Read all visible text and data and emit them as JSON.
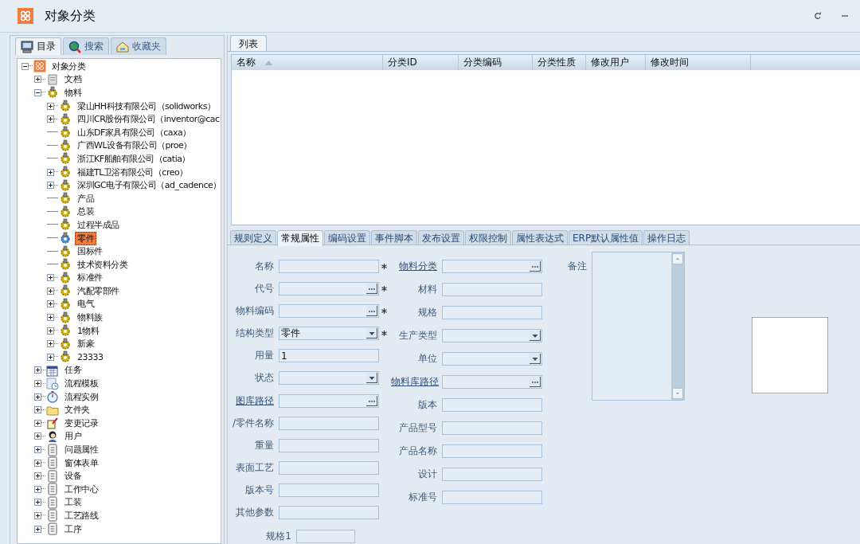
{
  "window": {
    "title": "对象分类"
  },
  "left_tabs": [
    {
      "label": "目录",
      "kind": "monitor",
      "selected": true
    },
    {
      "label": "搜索",
      "kind": "search",
      "selected": false
    },
    {
      "label": "收藏夹",
      "kind": "favorites",
      "selected": false
    }
  ],
  "tree": [
    {
      "label": "对象分类",
      "kind": "app",
      "expanded": true,
      "selected": false,
      "children": [
        {
          "label": "文档",
          "kind": "doc",
          "expanded": false,
          "selected": false
        },
        {
          "label": "物料",
          "kind": "gear",
          "expanded": true,
          "selected": false,
          "children": [
            {
              "label": "梁山HH科技有限公司（solidworks）",
              "kind": "gear",
              "expanded": false,
              "selected": false
            },
            {
              "label": "四川CR股份有限公司（inventor@cac",
              "kind": "gear",
              "expanded": false,
              "selected": false
            },
            {
              "label": "山东DF家具有限公司（caxa）",
              "kind": "gear",
              "selected": false
            },
            {
              "label": "广西WL设备有限公司（proe）",
              "kind": "gear",
              "selected": false
            },
            {
              "label": "浙江KF船舶有限公司（catia）",
              "kind": "gear",
              "selected": false
            },
            {
              "label": "福建TL卫浴有限公司（creo）",
              "kind": "gear",
              "expanded": false,
              "selected": false
            },
            {
              "label": "深圳GC电子有限公司（ad_cadence）",
              "kind": "gear",
              "expanded": false,
              "selected": false
            },
            {
              "label": "产品",
              "kind": "gear",
              "selected": false
            },
            {
              "label": "总装",
              "kind": "gear",
              "selected": false
            },
            {
              "label": "过程半成品",
              "kind": "gear",
              "selected": false
            },
            {
              "label": "零件",
              "kind": "gear",
              "selected": true
            },
            {
              "label": "国标件",
              "kind": "gear",
              "selected": false
            },
            {
              "label": "技术资料分类",
              "kind": "gear",
              "selected": false
            },
            {
              "label": "标准件",
              "kind": "gear",
              "expanded": false,
              "selected": false
            },
            {
              "label": "汽配零部件",
              "kind": "gear",
              "expanded": false,
              "selected": false
            },
            {
              "label": "电气",
              "kind": "gear",
              "expanded": false,
              "selected": false
            },
            {
              "label": "物料族",
              "kind": "gear",
              "expanded": false,
              "selected": false
            },
            {
              "label": "1物料",
              "kind": "gear",
              "expanded": false,
              "selected": false
            },
            {
              "label": "新豪",
              "kind": "gear",
              "expanded": false,
              "selected": false
            },
            {
              "label": "23333",
              "kind": "gear",
              "expanded": false,
              "selected": false
            }
          ]
        },
        {
          "label": "任务",
          "kind": "calendar",
          "expanded": false,
          "selected": false
        },
        {
          "label": "流程模板",
          "kind": "template",
          "expanded": false,
          "selected": false
        },
        {
          "label": "流程实例",
          "kind": "clock",
          "expanded": false,
          "selected": false
        },
        {
          "label": "文件夹",
          "kind": "folder",
          "expanded": false,
          "selected": false
        },
        {
          "label": "变更记录",
          "kind": "note",
          "expanded": false,
          "selected": false
        },
        {
          "label": "用户",
          "kind": "user",
          "expanded": false,
          "selected": false
        },
        {
          "label": "问题属性",
          "kind": "form",
          "expanded": false,
          "selected": false
        },
        {
          "label": "窗体表单",
          "kind": "form",
          "expanded": false,
          "selected": false
        },
        {
          "label": "设备",
          "kind": "form",
          "expanded": false,
          "selected": false
        },
        {
          "label": "工作中心",
          "kind": "form",
          "expanded": false,
          "selected": false
        },
        {
          "label": "工装",
          "kind": "form",
          "expanded": false,
          "selected": false
        },
        {
          "label": "工艺路线",
          "kind": "form",
          "expanded": false,
          "selected": false
        },
        {
          "label": "工序",
          "kind": "form",
          "expanded": false,
          "selected": false
        }
      ]
    }
  ],
  "list_tabs": [
    {
      "label": "列表",
      "selected": true
    }
  ],
  "table": {
    "columns": [
      {
        "label": "名称",
        "sorted": true
      },
      {
        "label": "分类ID",
        "sorted": false
      },
      {
        "label": "分类编码",
        "sorted": false
      },
      {
        "label": "分类性质",
        "sorted": false
      },
      {
        "label": "修改用户",
        "sorted": false
      },
      {
        "label": "修改时间",
        "sorted": false
      }
    ]
  },
  "detail_tabs": [
    {
      "label": "规则定义",
      "selected": false
    },
    {
      "label": "常规属性",
      "selected": true
    },
    {
      "label": "编码设置",
      "selected": false
    },
    {
      "label": "事件脚本",
      "selected": false
    },
    {
      "label": "发布设置",
      "selected": false
    },
    {
      "label": "权限控制",
      "selected": false
    },
    {
      "label": "属性表达式",
      "selected": false
    },
    {
      "label": "ERP默认属性值",
      "selected": false
    },
    {
      "label": "操作日志",
      "selected": false
    }
  ],
  "form": {
    "left_fields": [
      {
        "label": "名称",
        "kind": "text",
        "required": true,
        "link": false
      },
      {
        "label": "代号",
        "kind": "lookup",
        "required": true,
        "link": false
      },
      {
        "label": "物料编码",
        "kind": "lookup",
        "required": true,
        "link": false
      },
      {
        "label": "结构类型",
        "kind": "dropdown",
        "value": "零件",
        "required": true,
        "link": false
      },
      {
        "label": "用量",
        "kind": "text",
        "value": "1",
        "required": false,
        "link": false
      },
      {
        "label": "状态",
        "kind": "dropdown",
        "required": false,
        "link": false
      },
      {
        "label": "图库路径",
        "kind": "lookup",
        "required": false,
        "link": true
      },
      {
        "label": "/零件名称",
        "kind": "text",
        "required": false,
        "link": false
      },
      {
        "label": "重量",
        "kind": "text",
        "required": false,
        "link": false
      },
      {
        "label": "表面工艺",
        "kind": "text",
        "required": false,
        "link": false
      },
      {
        "label": "版本号",
        "kind": "text",
        "required": false,
        "link": false
      },
      {
        "label": "其他参数",
        "kind": "text",
        "required": false,
        "link": false
      }
    ],
    "right_fields": [
      {
        "label": "物料分类",
        "kind": "lookup",
        "required": false,
        "link": true
      },
      {
        "label": "材料",
        "kind": "text",
        "required": false,
        "link": false
      },
      {
        "label": "规格",
        "kind": "text",
        "required": false,
        "link": false
      },
      {
        "label": "生产类型",
        "kind": "dropdown",
        "required": false,
        "link": false
      },
      {
        "label": "单位",
        "kind": "dropdown",
        "required": false,
        "link": false
      },
      {
        "label": "物料库路径",
        "kind": "lookup",
        "required": false,
        "link": true
      },
      {
        "label": "版本",
        "kind": "text",
        "required": false,
        "link": false
      },
      {
        "label": "产品型号",
        "kind": "text",
        "required": false,
        "link": false
      },
      {
        "label": "产品名称",
        "kind": "text",
        "required": false,
        "link": false
      },
      {
        "label": "设计",
        "kind": "text",
        "required": false,
        "link": false
      },
      {
        "label": "标准号",
        "kind": "text",
        "required": false,
        "link": false
      }
    ],
    "notes": {
      "label": "备注"
    },
    "extra_row": {
      "label": "规格1"
    }
  }
}
